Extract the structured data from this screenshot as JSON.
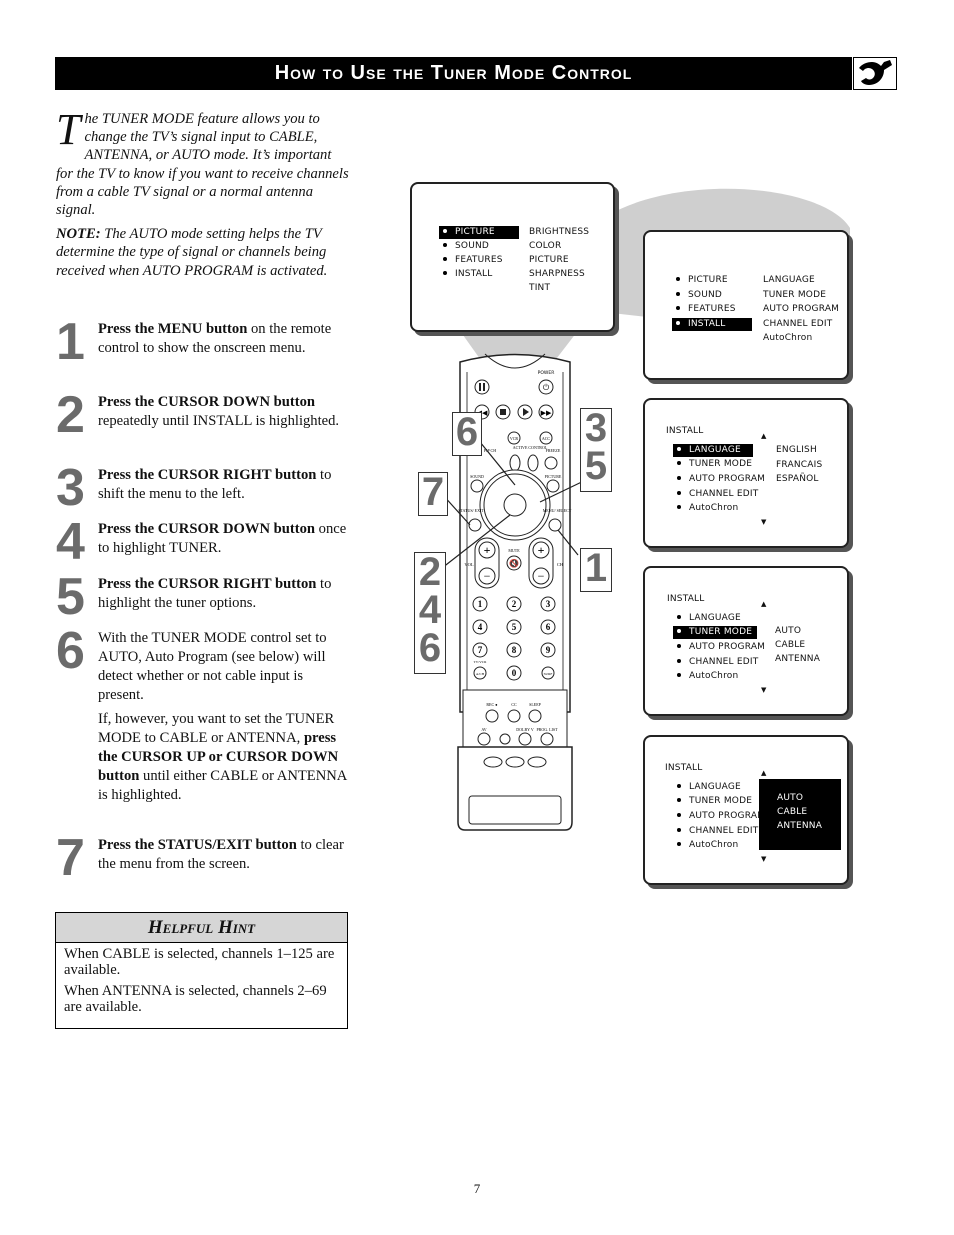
{
  "header": {
    "title": "How to Use the Tuner Mode Control",
    "icon": "wrench-icon"
  },
  "intro": {
    "dropcap": "T",
    "text": "he TUNER MODE feature allows you to change the TV’s signal input to CABLE, ANTENNA, or AUTO mode. It’s important for the TV to know if you want to receive channels from a cable TV signal or a normal antenna signal.",
    "note_label": "NOTE:",
    "note_text": " The AUTO mode setting helps the TV determine the type of signal or channels being received when AUTO PROGRAM is activated."
  },
  "steps": [
    {
      "num": "1",
      "bold": "Press the MENU button",
      "text": " on the remote control to show the onscreen menu."
    },
    {
      "num": "2",
      "bold": "Press the CURSOR DOWN button",
      "text": " repeatedly until INSTALL is highlighted."
    },
    {
      "num": "3",
      "bold": "Press the CURSOR RIGHT button",
      "text": " to shift the menu to the left."
    },
    {
      "num": "4",
      "bold": "Press the CURSOR DOWN button",
      "text": " once to highlight TUNER."
    },
    {
      "num": "5",
      "bold": "Press the CURSOR RIGHT button",
      "text": " to highlight the tuner options."
    },
    {
      "num": "6",
      "p1": "With the TUNER MODE control set to AUTO,  Auto Program (see below) will detect whether or not cable input is present.",
      "p2_a": "If, however, you want to set the TUNER MODE to CABLE or ANTENNA, ",
      "p2_bold": "press the CURSOR UP or CURSOR DOWN button",
      "p2_b": " until either CABLE or ANTENNA is highlighted."
    },
    {
      "num": "7",
      "bold": "Press the STATUS/EXIT button",
      "text": " to clear the menu from the screen."
    }
  ],
  "hint": {
    "title": "Helpful Hint",
    "lines": [
      "When CABLE is selected, channels 1–125 are available.",
      "When ANTENNA is selected, channels 2–69 are available."
    ]
  },
  "screens": {
    "main": {
      "left": [
        "PICTURE",
        "SOUND",
        "FEATURES",
        "INSTALL"
      ],
      "right": [
        "BRIGHTNESS",
        "COLOR",
        "PICTURE",
        "SHARPNESS",
        "TINT"
      ]
    },
    "install": {
      "left": [
        "PICTURE",
        "SOUND",
        "FEATURES",
        "INSTALL"
      ],
      "right": [
        "LANGUAGE",
        "TUNER  MODE",
        "AUTO  PROGRAM",
        "CHANNEL  EDIT",
        "AutoChron"
      ]
    },
    "language": {
      "title": "INSTALL",
      "left": [
        "LANGUAGE",
        "TUNER  MODE",
        "AUTO  PROGRAM",
        "CHANNEL  EDIT",
        "AutoChron"
      ],
      "right": [
        "ENGLISH",
        "FRANCAIS",
        "ESPAÑOL"
      ]
    },
    "tuner": {
      "title": "INSTALL",
      "left": [
        "LANGUAGE",
        "TUNER  MODE",
        "AUTO  PROGRAM",
        "CHANNEL  EDIT",
        "AutoChron"
      ],
      "right": [
        "AUTO",
        "CABLE",
        "ANTENNA"
      ]
    },
    "tuner_options": {
      "title": "INSTALL",
      "left": [
        "LANGUAGE",
        "TUNER  MODE",
        "AUTO  PROGRAM",
        "CHANNEL  EDIT",
        "AutoChron"
      ],
      "right": [
        "AUTO",
        "CABLE",
        "ANTENNA"
      ]
    }
  },
  "remote": {
    "labels": {
      "power": "POWER",
      "vcr": "VCR",
      "acc": "ACC",
      "pip_ch": "PIP CH",
      "up": "UP",
      "active_control": "ACTIVE CONTROL",
      "freeze": "FREEZE",
      "sound": "SOUND",
      "picture": "PICTURE",
      "status_exit": "STATUS/ EXIT",
      "menu_select": "MENU/ SELECT",
      "mute": "MUTE",
      "vol": "VOL",
      "ch": "CH",
      "tv_vcr": "TV/VCR",
      "ach": "A/CH",
      "surf": "SURF",
      "rec": "REC ●",
      "cc": "CC",
      "sleep": "SLEEP",
      "av": "AV",
      "dolby": "DOLBY V",
      "prog_list": "PROG. LIST"
    },
    "digits": [
      "1",
      "2",
      "3",
      "4",
      "5",
      "6",
      "7",
      "8",
      "9",
      "0"
    ],
    "callouts": {
      "top_left": "6",
      "left": "7",
      "right_top": "3\n5",
      "right": "1",
      "bottom_left": "2\n4\n6"
    }
  },
  "page_number": "7"
}
